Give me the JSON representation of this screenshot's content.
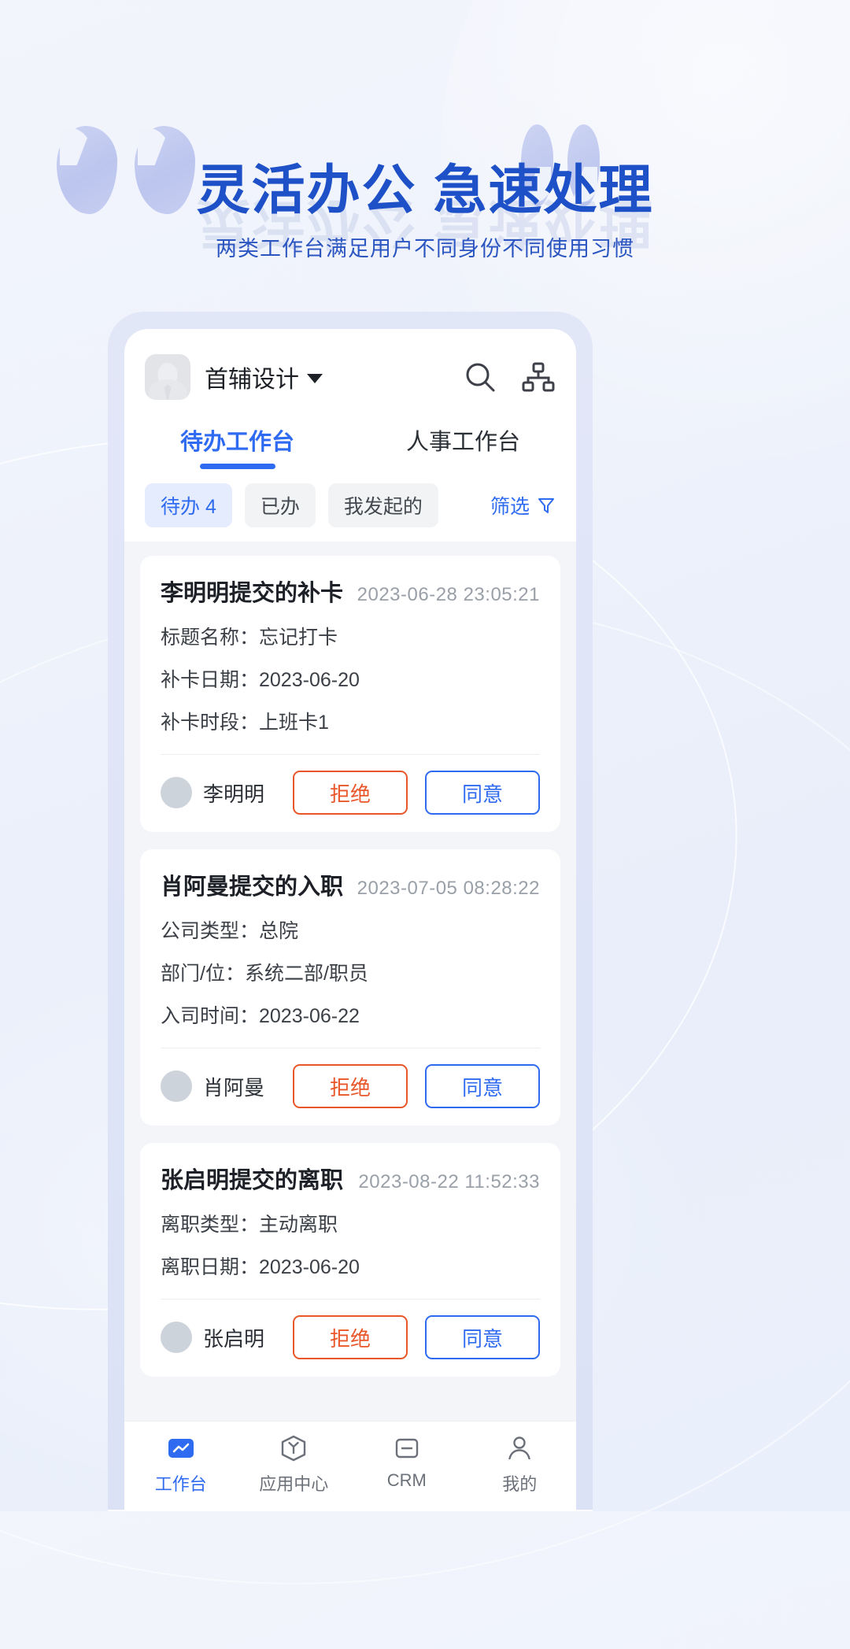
{
  "hero": {
    "title": "灵活办公 急速处理",
    "subtitle": "两类工作台满足用户不同身份不同使用习惯",
    "accent_color": "#1e50c8",
    "quote_open": "open-quote-mark",
    "quote_close": "close-quote-mark"
  },
  "app": {
    "header": {
      "org_name": "首辅设计",
      "avatar_label": "avatar",
      "dropdown_caret": "▼",
      "search_icon": "search-icon",
      "org_tree_icon": "org-structure-icon"
    },
    "tabs": [
      {
        "label": "待办工作台",
        "active": true
      },
      {
        "label": "人事工作台",
        "active": false
      }
    ],
    "chips": [
      {
        "label": "待办 4",
        "active": true
      },
      {
        "label": "已办",
        "active": false
      },
      {
        "label": "我发起的",
        "active": false
      }
    ],
    "filter": {
      "label": "筛选",
      "icon": "filter-icon"
    },
    "actions": {
      "reject": "拒绝",
      "approve": "同意"
    },
    "cards": [
      {
        "title": "李明明提交的补卡",
        "time": "2023-06-28 23:05:21",
        "fields": [
          "标题名称：忘记打卡",
          "补卡日期：2023-06-20",
          "补卡时段：上班卡1"
        ],
        "requester": "李明明"
      },
      {
        "title": "肖阿曼提交的入职",
        "time": "2023-07-05 08:28:22",
        "fields": [
          "公司类型：总院",
          "部门/位：系统二部/职员",
          "入司时间：2023-06-22"
        ],
        "requester": "肖阿曼"
      },
      {
        "title": "张启明提交的离职",
        "time": "2023-08-22 11:52:33",
        "fields": [
          "离职类型：主动离职",
          "离职日期：2023-06-20"
        ],
        "requester": "张启明"
      }
    ],
    "bottom_nav": [
      {
        "label": "工作台",
        "icon": "workbench-icon",
        "active": true
      },
      {
        "label": "应用中心",
        "icon": "app-center-icon",
        "active": false
      },
      {
        "label": "CRM",
        "icon": "crm-icon",
        "active": false
      },
      {
        "label": "我的",
        "icon": "profile-icon",
        "active": false
      }
    ],
    "colors": {
      "primary": "#2f6bf0",
      "reject": "#e8562a",
      "list_bg": "#f3f5f9"
    }
  }
}
